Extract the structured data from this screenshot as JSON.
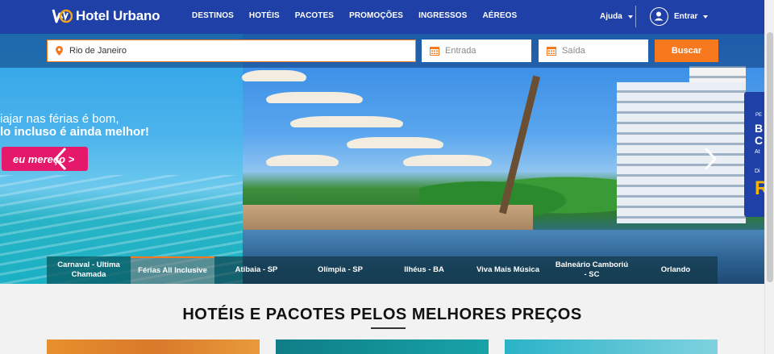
{
  "header": {
    "logo_text": "Hotel Urbano",
    "nav": [
      "DESTINOS",
      "HOTÉIS",
      "PACOTES",
      "PROMOÇÕES",
      "INGRESSOS",
      "AÉREOS"
    ],
    "help_label": "Ajuda",
    "login_label": "Entrar"
  },
  "search": {
    "destination_value": "Rio de Janeiro",
    "checkin_placeholder": "Entrada",
    "checkout_placeholder": "Saída",
    "search_label": "Buscar"
  },
  "hero": {
    "promo_line1": "iajar nas férias é bom,",
    "promo_line2": "lo incluso é ainda melhor!",
    "promo_button": "eu mereço >",
    "side_banner": {
      "t1": "PE",
      "t2": "B\nC",
      "t3": "At",
      "t4": "Di",
      "t5": "R"
    }
  },
  "tabs": [
    "Carnaval - Ultima Chamada",
    "Férias All Inclusive",
    "Atibaia - SP",
    "Olímpia - SP",
    "Ilhéus - BA",
    "Viva Mais Música",
    "Balneário Camboriú - SC",
    "Orlando"
  ],
  "section": {
    "title": "HOTÉIS E PACOTES PELOS MELHORES PREÇOS"
  },
  "colors": {
    "brand_blue": "#1f40a6",
    "accent_orange": "#f7781d",
    "promo_pink": "#e4196b"
  }
}
